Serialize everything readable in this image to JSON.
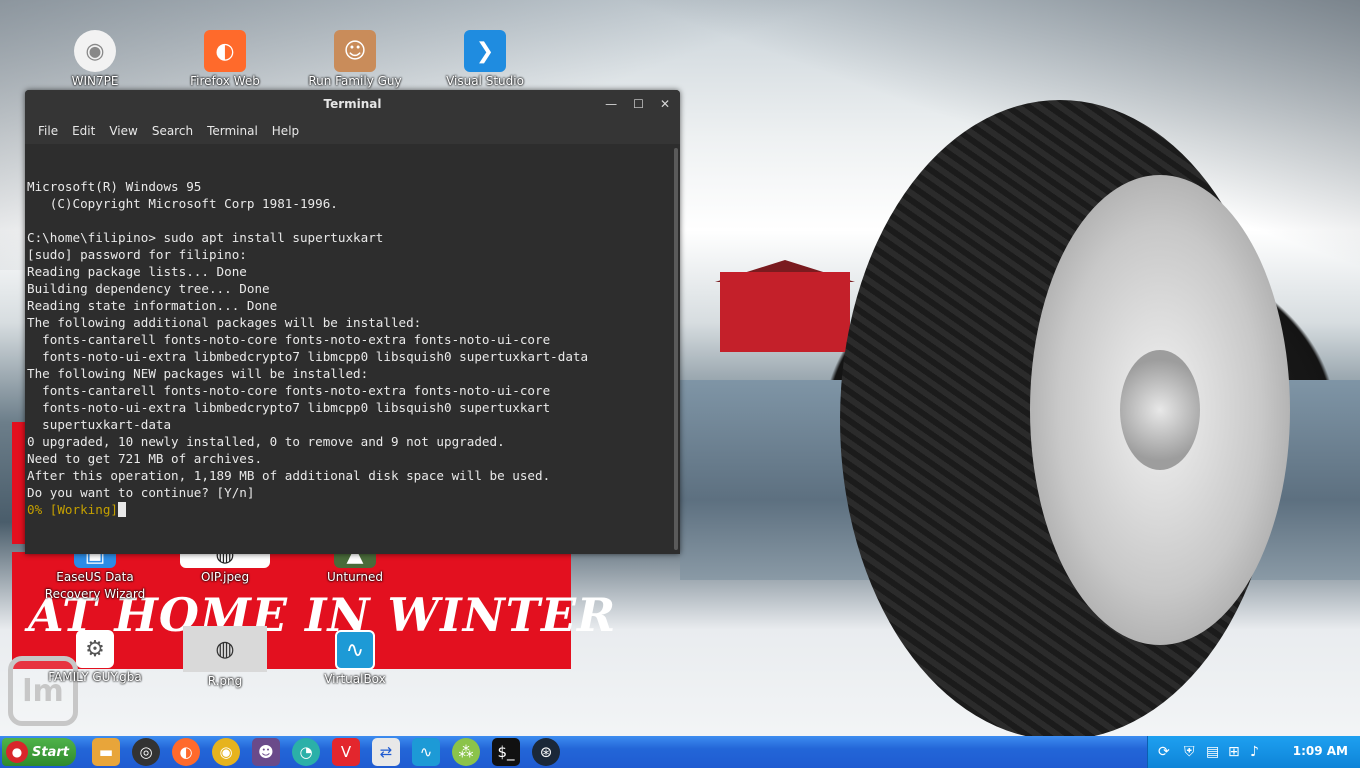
{
  "desktop": {
    "banner_text": "AT HOME IN WINTER",
    "icons": [
      {
        "label": "WIN7PE"
      },
      {
        "label": "Firefox Web"
      },
      {
        "label": "Run Family Guy"
      },
      {
        "label": "Visual Studio"
      },
      {
        "label": "EaseUS Data"
      },
      {
        "label": "Recovery Wizard"
      },
      {
        "label": "OIP.jpeg"
      },
      {
        "label": "Unturned"
      },
      {
        "label": "FAMILY GUY.gba"
      },
      {
        "label": "R.png"
      },
      {
        "label": "VirtualBox"
      }
    ]
  },
  "terminal": {
    "title": "Terminal",
    "menu": [
      "File",
      "Edit",
      "View",
      "Search",
      "Terminal",
      "Help"
    ],
    "lines": [
      "",
      "",
      "Microsoft(R) Windows 95",
      "   (C)Copyright Microsoft Corp 1981-1996.",
      "",
      "C:\\home\\filipino> sudo apt install supertuxkart",
      "[sudo] password for filipino:",
      "Reading package lists... Done",
      "Building dependency tree... Done",
      "Reading state information... Done",
      "The following additional packages will be installed:",
      "  fonts-cantarell fonts-noto-core fonts-noto-extra fonts-noto-ui-core",
      "  fonts-noto-ui-extra libmbedcrypto7 libmcpp0 libsquish0 supertuxkart-data",
      "The following NEW packages will be installed:",
      "  fonts-cantarell fonts-noto-core fonts-noto-extra fonts-noto-ui-core",
      "  fonts-noto-ui-extra libmbedcrypto7 libmcpp0 libsquish0 supertuxkart",
      "  supertuxkart-data",
      "0 upgraded, 10 newly installed, 0 to remove and 9 not upgraded.",
      "Need to get 721 MB of archives.",
      "After this operation, 1,189 MB of additional disk space will be used.",
      "Do you want to continue? [Y/n]"
    ],
    "progress_line": "0% [Working]"
  },
  "taskbar": {
    "start_label": "Start",
    "clock": "1:09 AM"
  },
  "colors": {
    "taskbar": "#1f5bd1",
    "start_button": "#2f8a2c",
    "terminal_bg": "#2d2d2d",
    "progress_text": "#c4a000",
    "banner": "#e3101f"
  }
}
